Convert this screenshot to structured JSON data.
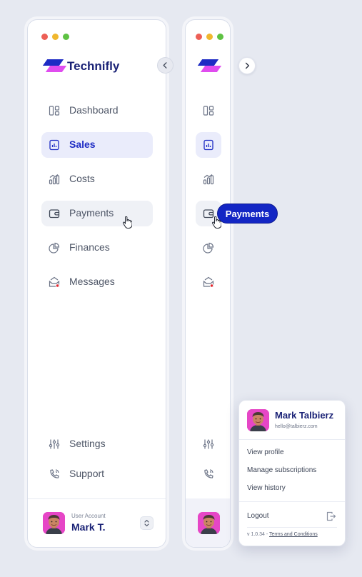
{
  "brand": {
    "name": "Technifly",
    "colors": {
      "primary": "#1d2bc4",
      "accent": "#e04cef",
      "text": "#1a2276"
    }
  },
  "window_controls": [
    "close-dot",
    "minimize-dot",
    "maximize-dot"
  ],
  "sidebar": {
    "items": [
      {
        "label": "Dashboard",
        "icon": "dashboard-icon",
        "state": "default"
      },
      {
        "label": "Sales",
        "icon": "sales-icon",
        "state": "active"
      },
      {
        "label": "Costs",
        "icon": "bar-chart-icon",
        "state": "default"
      },
      {
        "label": "Payments",
        "icon": "wallet-icon",
        "state": "hover"
      },
      {
        "label": "Finances",
        "icon": "pie-chart-icon",
        "state": "default"
      },
      {
        "label": "Messages",
        "icon": "inbox-icon",
        "state": "default",
        "notification_dot": true
      }
    ],
    "bottom_items": [
      {
        "label": "Settings",
        "icon": "sliders-icon"
      },
      {
        "label": "Support",
        "icon": "phone-icon"
      }
    ],
    "account": {
      "caption": "User Account",
      "name": "Mark T."
    }
  },
  "collapsed_sidebar": {
    "tooltip": "Payments"
  },
  "profile_menu": {
    "name": "Mark Talbierz",
    "email": "hello@talbierz.com",
    "links": [
      "View profile",
      "Manage subscriptions",
      "View history"
    ],
    "logout": "Logout",
    "version": "v 1.0.34 -",
    "terms": "Terms and Conditions"
  }
}
